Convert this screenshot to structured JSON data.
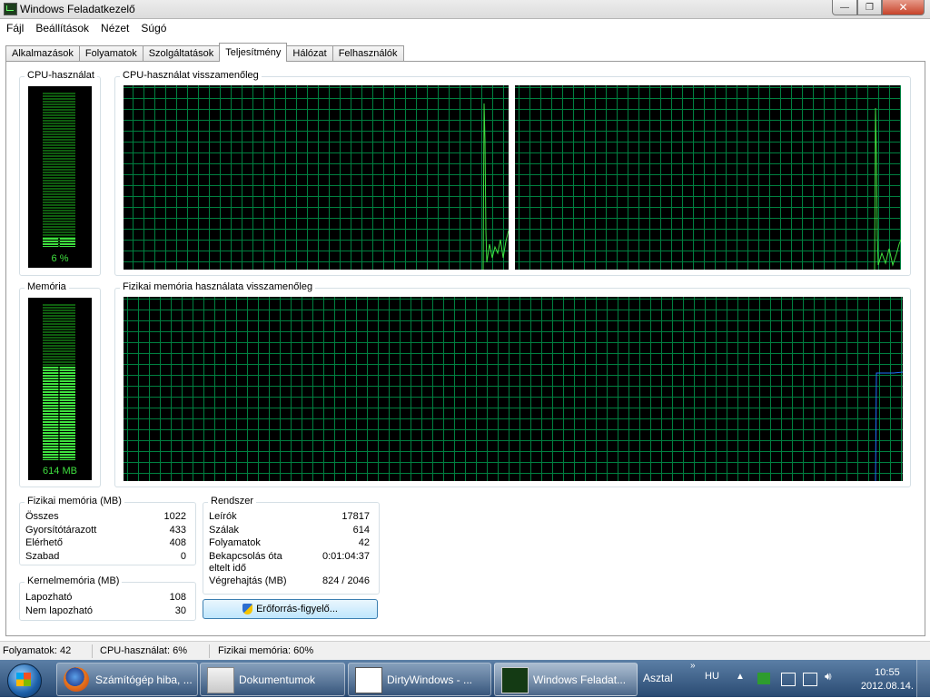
{
  "window": {
    "title": "Windows Feladatkezelő",
    "min": "—",
    "max": "❐",
    "close": "✕"
  },
  "menu": [
    "Fájl",
    "Beállítások",
    "Nézet",
    "Súgó"
  ],
  "tabs": [
    "Alkalmazások",
    "Folyamatok",
    "Szolgáltatások",
    "Teljesítmény",
    "Hálózat",
    "Felhasználók"
  ],
  "active_tab": "Teljesítmény",
  "cpu": {
    "group_label": "CPU-használat",
    "value_label": "6 %",
    "percent": 6,
    "history_label": "CPU-használat visszamenőleg"
  },
  "memory": {
    "group_label": "Memória",
    "value_label": "614 MB",
    "used_fraction": 0.6,
    "history_label": "Fizikai memória használata visszamenőleg"
  },
  "physical": {
    "label": "Fizikai memória (MB)",
    "rows": [
      {
        "k": "Összes",
        "v": "1022"
      },
      {
        "k": "Gyorsítótárazott",
        "v": "433"
      },
      {
        "k": "Elérhető",
        "v": "408"
      },
      {
        "k": "Szabad",
        "v": "0"
      }
    ]
  },
  "kernel": {
    "label": "Kernelmemória (MB)",
    "rows": [
      {
        "k": "Lapozható",
        "v": "108"
      },
      {
        "k": "Nem lapozható",
        "v": "30"
      }
    ]
  },
  "system": {
    "label": "Rendszer",
    "rows": [
      {
        "k": "Leírók",
        "v": "17817"
      },
      {
        "k": "Szálak",
        "v": "614"
      },
      {
        "k": "Folyamatok",
        "v": "42"
      }
    ],
    "uptime_k1": "Bekapcsolás óta",
    "uptime_k2": "eltelt idő",
    "uptime_v": "0:01:04:37",
    "commit_k": "Végrehajtás (MB)",
    "commit_v": "824 / 2046"
  },
  "resource_button": "Erőforrás-figyelő...",
  "status": {
    "processes": "Folyamatok: 42",
    "cpu": "CPU-használat: 6%",
    "memory": "Fizikai memória: 60%"
  },
  "taskbar": {
    "items": [
      "Számítógép hiba, ...",
      "Dokumentumok",
      "DirtyWindows - ...",
      "Windows Feladat..."
    ],
    "desktop": "Asztal",
    "lang": "HU",
    "time": "10:55",
    "date": "2012.08.14."
  },
  "colors": {
    "graph_line": "#3fe03f",
    "grid": "#008040",
    "memory_line": "#1e6fff"
  }
}
